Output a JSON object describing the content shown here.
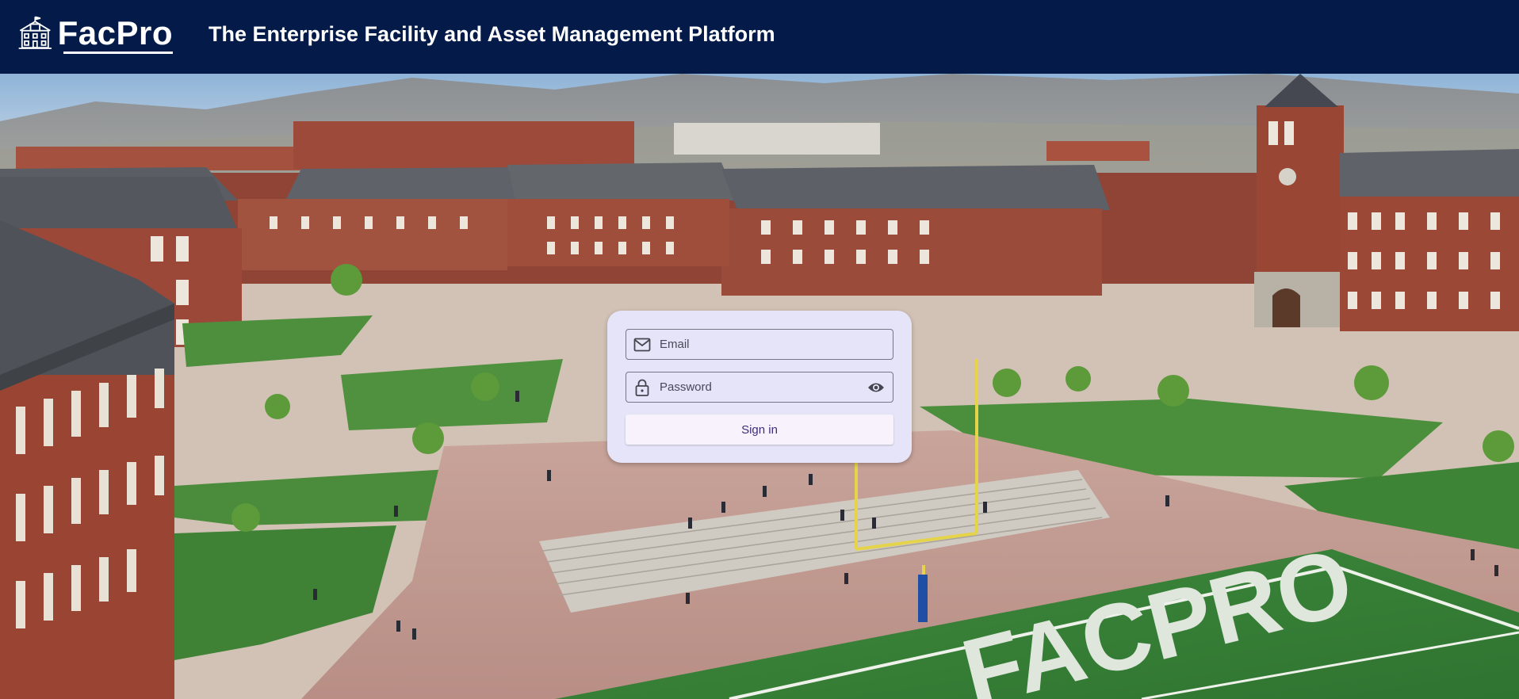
{
  "header": {
    "logo_text": "FacPro",
    "tagline": "The Enterprise Facility and Asset Management Platform"
  },
  "background": {
    "field_lettering": "FACPRO"
  },
  "login": {
    "email_placeholder": "Email",
    "password_placeholder": "Password",
    "sign_in_label": "Sign in"
  },
  "colors": {
    "header_bg": "#041b4a",
    "card_bg": "#e6e4f9",
    "button_text": "#3c2f7a"
  },
  "icons": [
    "building-icon",
    "email-icon",
    "lock-icon",
    "eye-icon"
  ]
}
